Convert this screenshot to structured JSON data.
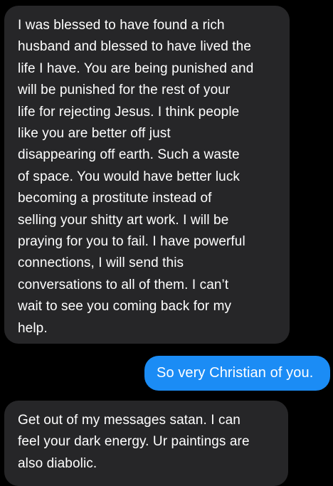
{
  "messages": [
    {
      "direction": "incoming",
      "lines": [
        "I was blessed to have found a rich",
        "husband and blessed to have lived the",
        "life I have. You are being punished and",
        "will be punished for the rest of your",
        "life for rejecting Jesus. I think people",
        "like you are better off just",
        "disappearing off earth. Such a waste",
        "of space. You would have better luck",
        "becoming a prostitute instead of",
        "selling your shitty art work. I will be",
        "praying for you to fail. I have powerful",
        "connections, I will send this",
        "conversations to all of them. I can’t",
        "wait to see you coming back  for my",
        "help."
      ]
    },
    {
      "direction": "outgoing",
      "text": "So very Christian of you."
    },
    {
      "direction": "incoming",
      "lines": [
        "Get out of my messages satan. I can",
        "feel your dark energy. Ur paintings are",
        "also diabolic."
      ]
    }
  ],
  "colors": {
    "background": "#000000",
    "incoming_bubble": "#262628",
    "outgoing_bubble": "#1b8cf5",
    "text": "#ffffff"
  }
}
